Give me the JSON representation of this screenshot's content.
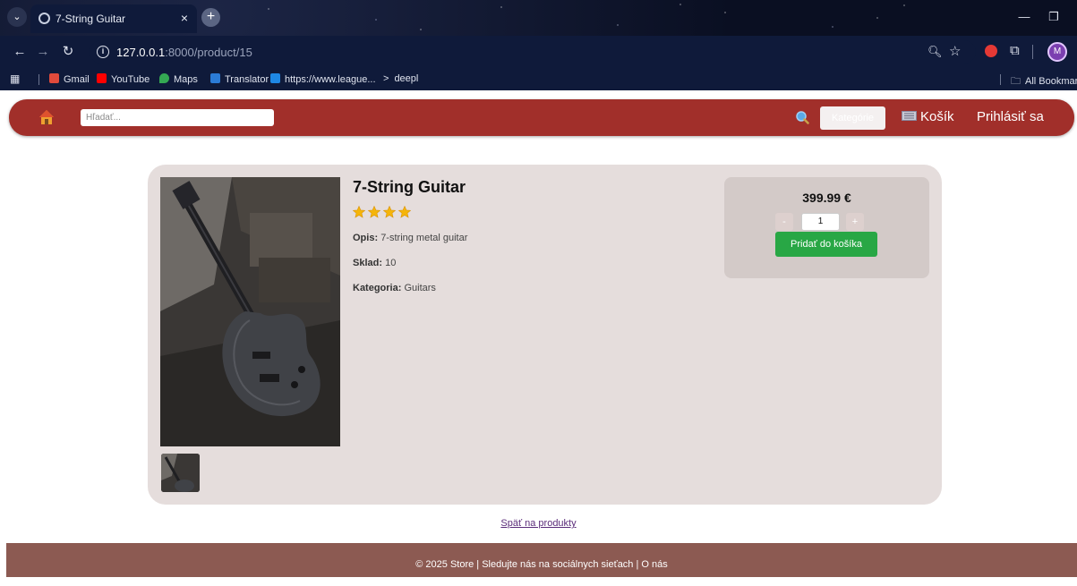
{
  "browser": {
    "tab_title": "7-String Guitar",
    "tab_close": "×",
    "new_tab": "+",
    "url_host": "127.0.0.1",
    "url_path": ":8000/product/15",
    "bookmarks": {
      "gmail": "Gmail",
      "youtube": "YouTube",
      "maps": "Maps",
      "translator": "Translator",
      "league": "https://www.league...",
      "deepl": "deepl",
      "all": "All Bookmar"
    },
    "profile_initial": "M"
  },
  "header": {
    "search_placeholder": "Hľadať...",
    "category_label": "Kategórie",
    "cart_label": "Košík",
    "login_label": "Prihlásiť sa",
    "colors": {
      "bar": "#a12f2a"
    }
  },
  "product": {
    "title": "7-String Guitar",
    "rating": 4,
    "description_label": "Opis:",
    "description": "7-string metal guitar",
    "stock_label": "Sklad:",
    "stock": "10",
    "category_label": "Kategoria:",
    "category": "Guitars",
    "price": "399.99 €",
    "quantity": "1",
    "qty_minus": "-",
    "qty_plus": "+",
    "add_to_cart": "Pridať do košíka",
    "colors": {
      "card": "#e5dddc",
      "buy_box": "#d3cac8",
      "add_button": "#28a745"
    }
  },
  "back_link": "Späť na produkty",
  "footer": {
    "text": "© 2025 Store | Sledujte nás na sociálnych sieťach | O nás",
    "color": "#8c5a52"
  }
}
